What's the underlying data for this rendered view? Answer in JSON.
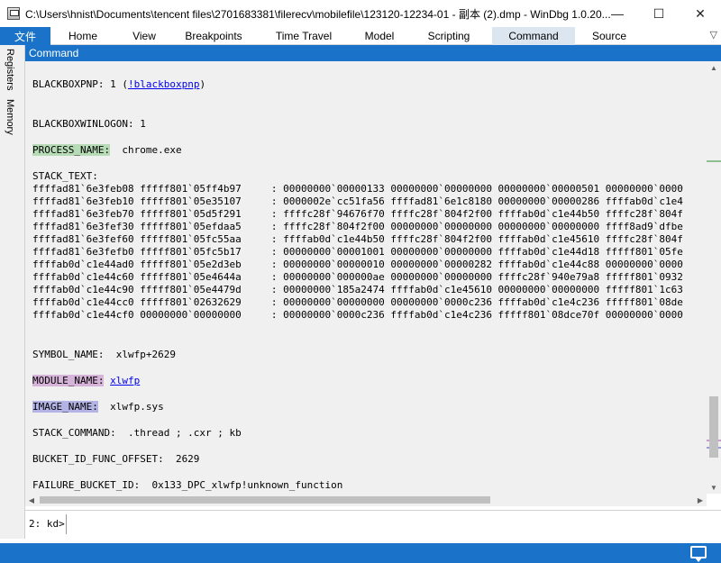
{
  "window": {
    "title": "C:\\Users\\hnist\\Documents\\tencent files\\2701683381\\filerecv\\mobilefile\\123120-12234-01 - 副本 (2).dmp - WinDbg 1.0.20...",
    "minimize": "—",
    "maximize": "☐",
    "close": "✕"
  },
  "ribbon": {
    "file": "文件",
    "tabs": [
      "Home",
      "View",
      "Breakpoints",
      "Time Travel",
      "Model",
      "Scripting",
      "Command",
      "Source"
    ],
    "active_tab": "Command",
    "chevron": "▽"
  },
  "left_panel": {
    "tabs": [
      "Registers",
      "Memory"
    ]
  },
  "command_window": {
    "header": "Command",
    "lines": {
      "blackbox_label": "BLACKBOXPNP: 1 (",
      "blackbox_link": "!blackboxpnp",
      "blackbox_end": ")",
      "winlogon": "BLACKBOXWINLOGON: 1",
      "process_key": "PROCESS_NAME:",
      "process_value": "  chrome.exe",
      "stack_text": "STACK_TEXT:",
      "symbol": "SYMBOL_NAME:  xlwfp+2629",
      "module_key": "MODULE_NAME:",
      "module_link": "xlwfp",
      "image_key": "IMAGE_NAME:",
      "image_value": "  xlwfp.sys",
      "stack_command": "STACK_COMMAND:  .thread ; .cxr ; kb",
      "bucket_offset": "BUCKET_ID_FUNC_OFFSET:  2629",
      "failure_bucket": "FAILURE_BUCKET_ID:  0x133_DPC_xlwfp!unknown_function"
    },
    "stack_rows": [
      "ffffad81`6e3feb08 fffff801`05ff4b97     : 00000000`00000133 00000000`00000000 00000000`00000501 00000000`0000",
      "ffffad81`6e3feb10 fffff801`05e35107     : 0000002e`cc51fa56 ffffad81`6e1c8180 00000000`00000286 ffffab0d`c1e4",
      "ffffad81`6e3feb70 fffff801`05d5f291     : ffffc28f`94676f70 ffffc28f`804f2f00 ffffab0d`c1e44b50 ffffc28f`804f",
      "ffffad81`6e3fef30 fffff801`05efdaa5     : ffffc28f`804f2f00 00000000`00000000 00000000`00000000 ffff8ad9`dfbe",
      "ffffad81`6e3fef60 fffff801`05fc55aa     : ffffab0d`c1e44b50 ffffc28f`804f2f00 ffffab0d`c1e45610 ffffc28f`804f",
      "ffffad81`6e3fefb0 fffff801`05fc5b17     : 00000000`00001001 00000000`00000000 ffffab0d`c1e44d18 fffff801`05fe",
      "ffffab0d`c1e44ad0 fffff801`05e2d3eb     : 00000000`00000010 00000000`00000282 ffffab0d`c1e44c88 00000000`0000",
      "ffffab0d`c1e44c60 fffff801`05e4644a     : 00000000`000000ae 00000000`00000000 ffffc28f`940e79a8 fffff801`0932",
      "ffffab0d`c1e44c90 fffff801`05e4479d     : 00000000`185a2474 ffffab0d`c1e45610 00000000`00000000 fffff801`1c63",
      "ffffab0d`c1e44cc0 fffff801`02632629     : 00000000`00000000 00000000`0000c236 ffffab0d`c1e4c236 fffff801`08de",
      "ffffab0d`c1e44cf0 00000000`00000000     : 00000000`0000c236 ffffab0d`c1e4c236 fffff801`08dce70f 00000000`0000"
    ]
  },
  "input": {
    "prompt": "2: kd>",
    "value": ""
  },
  "colors": {
    "accent": "#1a73c8",
    "process_highlight": "#b6dbb6",
    "module_highlight": "#d6b3d9",
    "image_highlight": "#b3b3e6"
  }
}
